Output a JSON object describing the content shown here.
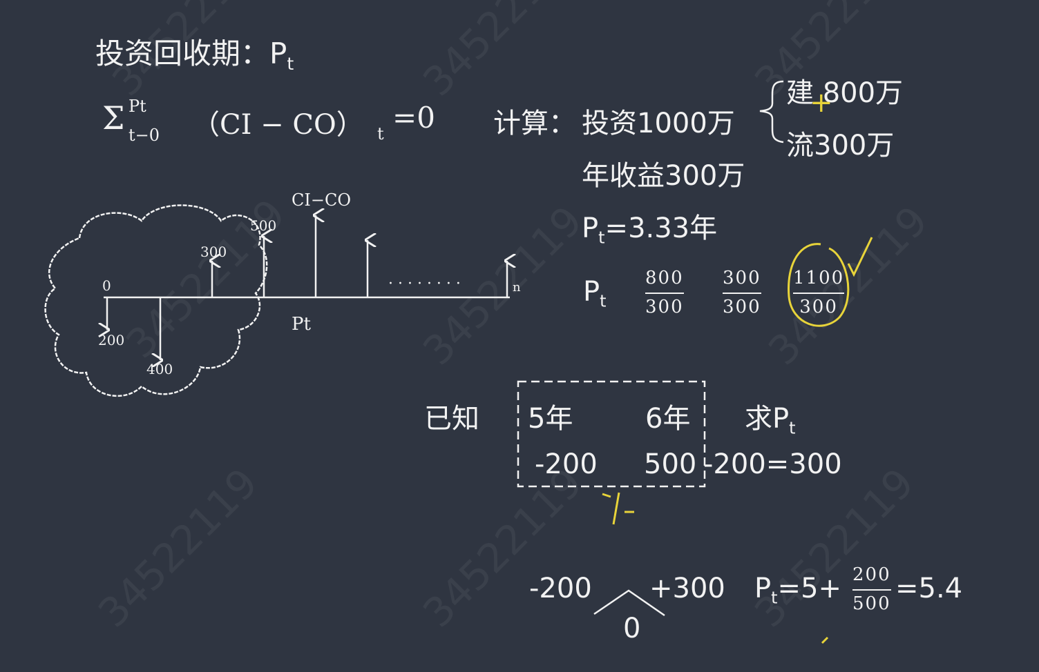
{
  "title": {
    "main": "投资回收期：P",
    "sub": "t"
  },
  "formula": {
    "sigma": "Σ",
    "upper": "Pt",
    "lower": "t−0",
    "body": "（CI − CO）",
    "sub_t": "t",
    "eq": "=0"
  },
  "calc": {
    "label": "计算：",
    "invest": "投资1000万",
    "brace_top": "建 800万",
    "brace_bottom": "流300万",
    "annual": "年收益300万",
    "pt_main": "P",
    "pt_sub": "t",
    "pt_value": "=3.33年",
    "mark_plus": "+"
  },
  "fractions": {
    "label_main": "P",
    "label_sub": "t",
    "items": [
      {
        "num": "800",
        "den": "300"
      },
      {
        "num": "300",
        "den": "300"
      },
      {
        "num": "1100",
        "den": "300"
      }
    ]
  },
  "cashflow": {
    "top_label": "CI−CO",
    "labels": [
      "0",
      "200",
      "400",
      "300",
      "500",
      "n",
      "Pt"
    ],
    "dots": "· · · · · · · ·"
  },
  "known": {
    "label": "已知",
    "year5": "5年",
    "year6": "6年",
    "val5": "-200",
    "val6": "500",
    "tail": "-200=300",
    "ask": "求P",
    "ask_sub": "t"
  },
  "bottom": {
    "left": "-200",
    "right": "+300",
    "zero": "0",
    "pt_main": "P",
    "pt_sub": "t",
    "eq_start": "=5+",
    "frac_num": "200",
    "frac_den": "500",
    "eq_end": "=5.4"
  },
  "watermark": "34522119",
  "colors": {
    "background": "#2f3541",
    "chalk": "#f2f2f2",
    "highlight": "#e8d43a"
  }
}
